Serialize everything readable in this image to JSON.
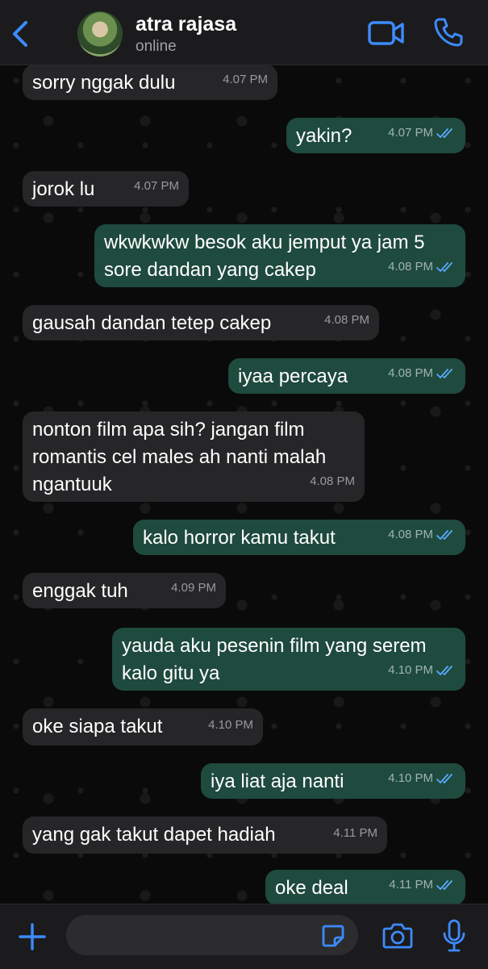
{
  "header": {
    "contact_name": "atra rajasa",
    "status": "online"
  },
  "colors": {
    "accent": "#3d8bff",
    "incoming_bubble": "#262628",
    "outgoing_bubble": "#1f4a3e",
    "read_tick": "#5aa9ff"
  },
  "messages": [
    {
      "dir": "in",
      "text": "sorry nggak dulu",
      "time": "4.07 PM"
    },
    {
      "dir": "out",
      "text": "yakin?",
      "time": "4.07 PM",
      "status": "read"
    },
    {
      "dir": "in",
      "text": "jorok lu",
      "time": "4.07 PM"
    },
    {
      "dir": "out",
      "text": "wkwkwkw besok aku jemput ya jam 5 sore dandan yang cakep",
      "time": "4.08 PM",
      "status": "read"
    },
    {
      "dir": "in",
      "text": "gausah dandan tetep cakep",
      "time": "4.08 PM"
    },
    {
      "dir": "out",
      "text": "iyaa percaya",
      "time": "4.08 PM",
      "status": "read"
    },
    {
      "dir": "in",
      "text": "nonton film apa sih? jangan film romantis cel males ah nanti malah ngantuuk",
      "time": "4.08 PM"
    },
    {
      "dir": "out",
      "text": "kalo horror kamu takut",
      "time": "4.08 PM",
      "status": "read"
    },
    {
      "dir": "in",
      "text": "enggak tuh",
      "time": "4.09 PM"
    },
    {
      "dir": "out",
      "text": "yauda aku pesenin film yang serem kalo gitu ya",
      "time": "4.10 PM",
      "status": "read"
    },
    {
      "dir": "in",
      "text": "oke siapa takut",
      "time": "4.10 PM"
    },
    {
      "dir": "out",
      "text": "iya liat aja nanti",
      "time": "4.10 PM",
      "status": "read"
    },
    {
      "dir": "in",
      "text": "yang gak takut dapet hadiah",
      "time": "4.11 PM"
    },
    {
      "dir": "out",
      "text": "oke deal",
      "time": "4.11 PM",
      "status": "read"
    }
  ],
  "composer": {
    "input_value": "",
    "input_placeholder": ""
  }
}
